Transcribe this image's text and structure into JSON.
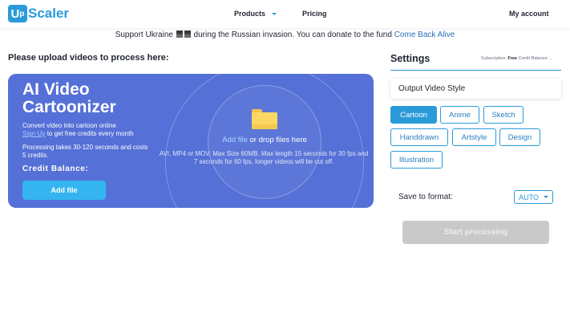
{
  "header": {
    "logo_letter": "U",
    "logo_suffix": "p",
    "logo_text": "Scaler",
    "nav": {
      "products": "Products",
      "pricing": "Pricing",
      "account": "My account"
    }
  },
  "banner": {
    "text": "Support Ukraine ",
    "text2": " during the Russian invasion. You can donate to the fund ",
    "link": "Come Back Alive"
  },
  "upload": {
    "title": "Please upload videos to process here:",
    "card_title": "AI Video Cartoonizer",
    "line1": "Convert video into cartoon online",
    "signup": "Sign Up",
    "line2": " to get free credits every month",
    "processing": "Processing takes 30-120 seconds and costs 5 credits.",
    "credit_balance": "Credit Balance:",
    "add_file_button": "Add file",
    "drop_link": "Add file",
    "drop_text": " or drop files here",
    "drop_info": "AVI, MP4 or MOV. Max Size 60MB. Max length 15 seconds for 30 fps and 7 seconds for 60 fps, longer videos will be cut off."
  },
  "settings": {
    "title": "Settings",
    "subscription_label": "Subscription:",
    "subscription_value": "Free",
    "credit_label": "Credit Balance: ..",
    "output_style_label": "Output Video Style",
    "styles": [
      "Cartoon",
      "Anime",
      "Sketch",
      "Handdrawn",
      "Artstyle",
      "Design",
      "Illustration"
    ],
    "selected_style": "Cartoon",
    "save_format_label": "Save to format:",
    "format_value": "AUTO",
    "start_button": "Start processing"
  },
  "colors": {
    "accent": "#2a9bd8",
    "card": "#5570d6",
    "add_button": "#34b5f0",
    "disabled": "#c9c9c9"
  }
}
